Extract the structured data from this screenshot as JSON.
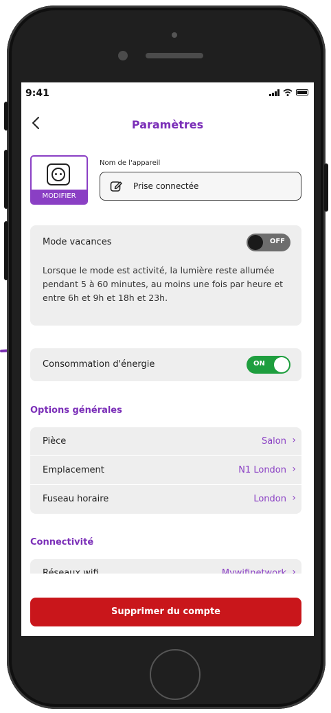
{
  "status_bar": {
    "time": "9:41"
  },
  "header": {
    "title": "Paramètres",
    "back_icon": "chevron-left-icon"
  },
  "device": {
    "icon": "plug-socket-icon",
    "modify_label": "MODIFIER",
    "name_label": "Nom de l'appareil",
    "name_value": "Prise connectée",
    "edit_icon": "edit-icon"
  },
  "vacation": {
    "label": "Mode vacances",
    "toggle_state": "OFF",
    "description": "Lorsque le mode est activité, la lumière reste allumée pendant 5 à 60 minutes, au moins une fois par heure et entre 6h et 9h et 18h et 23h."
  },
  "energy": {
    "label": "Consommation d'énergie",
    "toggle_state": "ON"
  },
  "general_options": {
    "title": "Options générales",
    "items": [
      {
        "label": "Pièce",
        "value": "Salon"
      },
      {
        "label": "Emplacement",
        "value": "N1 London"
      },
      {
        "label": "Fuseau horaire",
        "value": "London"
      }
    ]
  },
  "connectivity": {
    "title": "Connectivité",
    "items": [
      {
        "label": "Réseaux wifi",
        "value": "Mywifinetwork"
      }
    ]
  },
  "delete_button": {
    "label": "Supprimer du compte"
  },
  "colors": {
    "accent": "#7b2fb8",
    "toggle_on": "#1e9e3e",
    "danger": "#c9161b",
    "arrow": "#7a2fb0"
  }
}
